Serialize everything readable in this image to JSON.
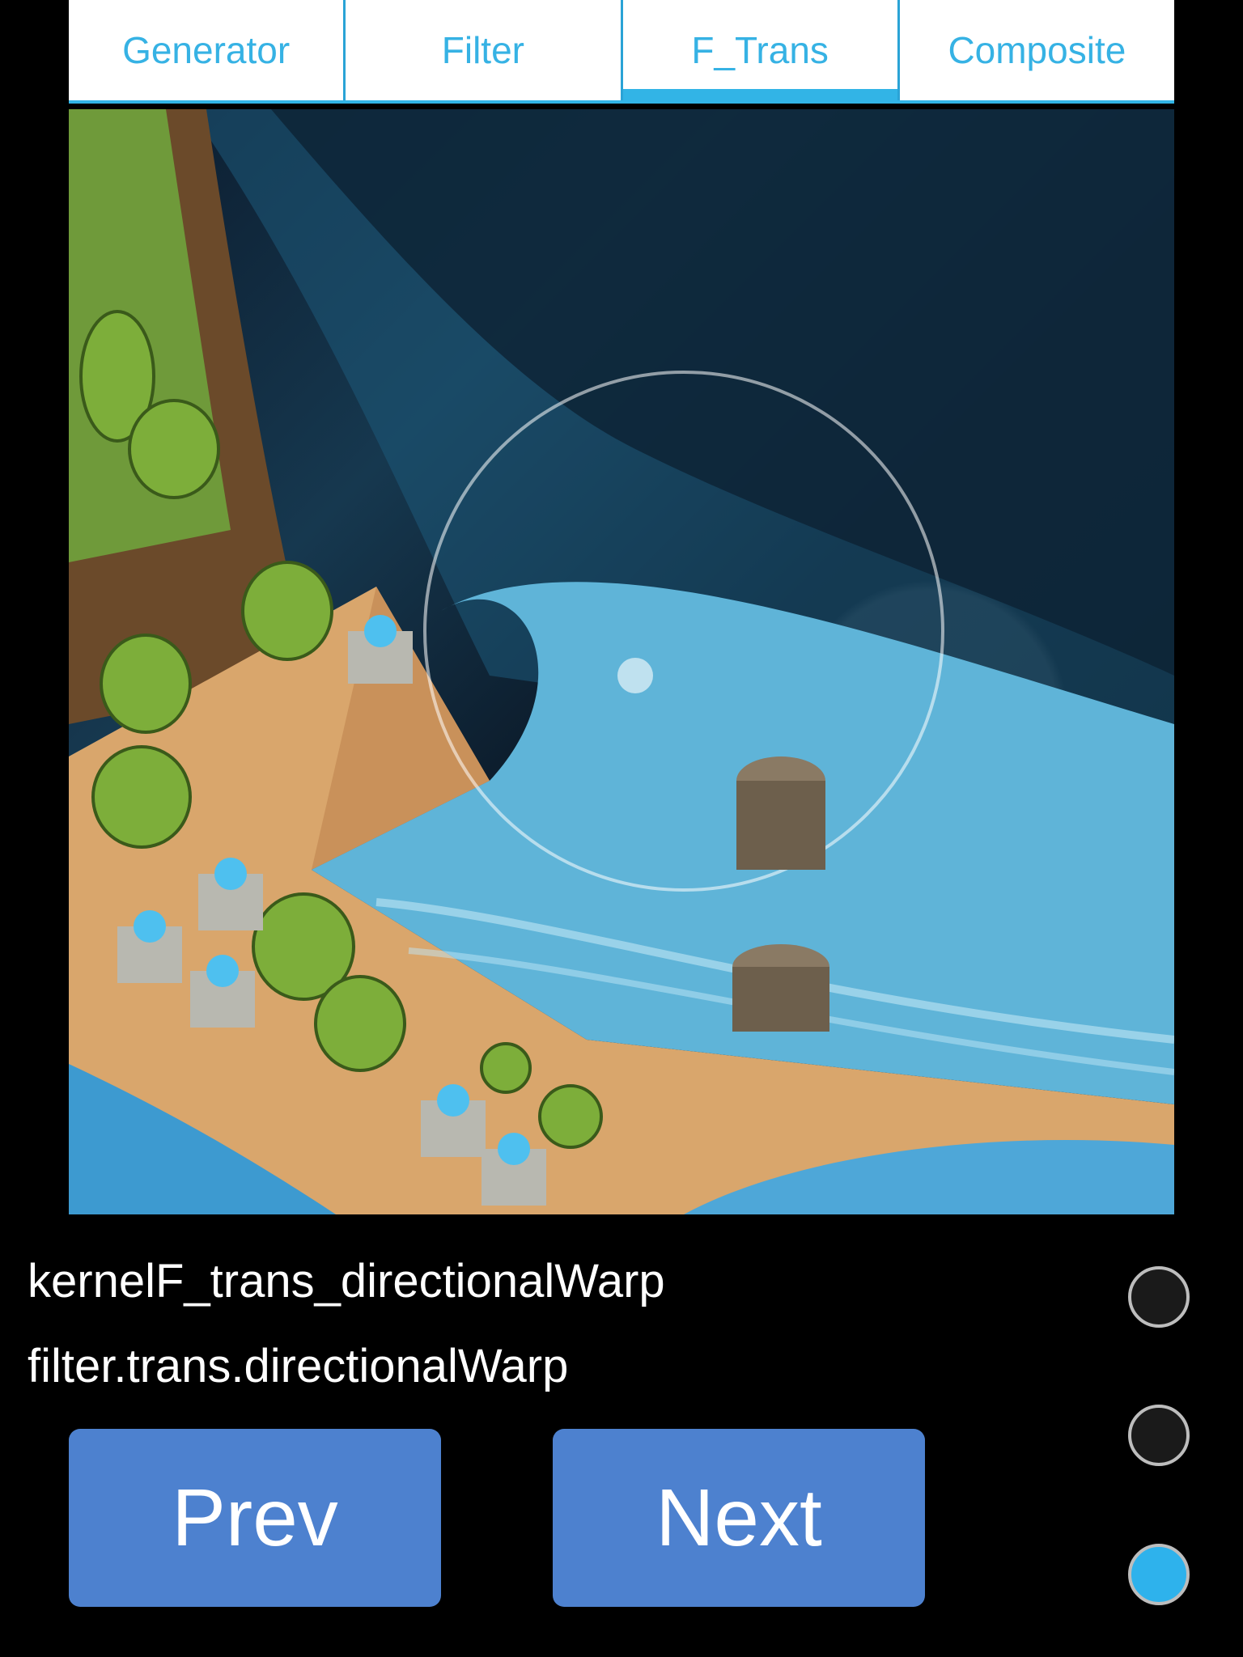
{
  "tabs": [
    {
      "label": "Generator",
      "active": false
    },
    {
      "label": "Filter",
      "active": false
    },
    {
      "label": "F_Trans",
      "active": true
    },
    {
      "label": "Composite",
      "active": false
    }
  ],
  "preview": {
    "description": "isometric pixel-art island with waterfall and directional warp effect"
  },
  "kernel_name": "kernelF_trans_directionalWarp",
  "filter_name": "filter.trans.directionalWarp",
  "buttons": {
    "prev_label": "Prev",
    "next_label": "Next"
  },
  "radios": [
    {
      "selected": false
    },
    {
      "selected": false
    },
    {
      "selected": true
    }
  ],
  "colors": {
    "accent": "#32b4e6",
    "button": "#4d81cf",
    "background": "#000000"
  }
}
